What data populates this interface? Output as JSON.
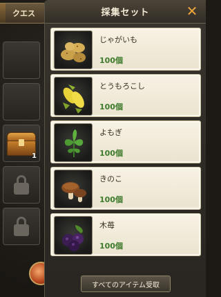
{
  "left": {
    "quest_tab_label": "クエス",
    "slots": [
      {
        "type": "empty"
      },
      {
        "type": "empty"
      },
      {
        "type": "chest",
        "count": "1"
      },
      {
        "type": "locked"
      },
      {
        "type": "locked"
      }
    ]
  },
  "panel": {
    "title": "採集セット",
    "close_label": "✕",
    "items": [
      {
        "name": "じゃがいも",
        "qty": "100個",
        "icon": "potato-icon"
      },
      {
        "name": "とうもろこし",
        "qty": "100個",
        "icon": "corn-icon"
      },
      {
        "name": "よもぎ",
        "qty": "100個",
        "icon": "mugwort-icon"
      },
      {
        "name": "きのこ",
        "qty": "100個",
        "icon": "mushroom-icon"
      },
      {
        "name": "木苺",
        "qty": "100個",
        "icon": "raspberry-icon"
      }
    ],
    "receive_all_label": "すべてのアイテム受取"
  }
}
